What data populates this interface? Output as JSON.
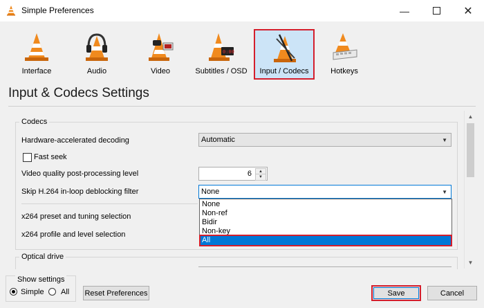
{
  "window": {
    "title": "Simple Preferences"
  },
  "categories": [
    {
      "label": "Interface",
      "icon": "cone-icon"
    },
    {
      "label": "Audio",
      "icon": "headphones-cone-icon"
    },
    {
      "label": "Video",
      "icon": "cone-glasses-icon"
    },
    {
      "label": "Subtitles / OSD",
      "icon": "cone-clock-icon"
    },
    {
      "label": "Input / Codecs",
      "icon": "cone-cables-icon",
      "selected": true
    },
    {
      "label": "Hotkeys",
      "icon": "cone-keyboard-icon"
    }
  ],
  "page": {
    "title": "Input & Codecs Settings"
  },
  "codecs": {
    "group_title": "Codecs",
    "hw_decoding_label": "Hardware-accelerated decoding",
    "hw_decoding_value": "Automatic",
    "fast_seek_label": "Fast seek",
    "fast_seek_checked": false,
    "pp_level_label": "Video quality post-processing level",
    "pp_level_value": "6",
    "skip_h264_label": "Skip H.264 in-loop deblocking filter",
    "skip_h264_value": "None",
    "x264_preset_label": "x264 preset and tuning selection",
    "x264_profile_label": "x264 profile and level selection"
  },
  "dropdown": {
    "options": [
      "None",
      "Non-ref",
      "Bidir",
      "Non-key",
      "All"
    ],
    "highlighted": "All"
  },
  "optical": {
    "group_title": "Optical drive"
  },
  "footer": {
    "show_settings_label": "Show settings",
    "simple_label": "Simple",
    "all_label": "All",
    "selected": "Simple",
    "reset_label": "Reset Preferences",
    "save_label": "Save",
    "cancel_label": "Cancel"
  },
  "colors": {
    "highlight": "#0078d7",
    "annotation_red": "#d41e2c",
    "cone_orange": "#f08a1e"
  }
}
